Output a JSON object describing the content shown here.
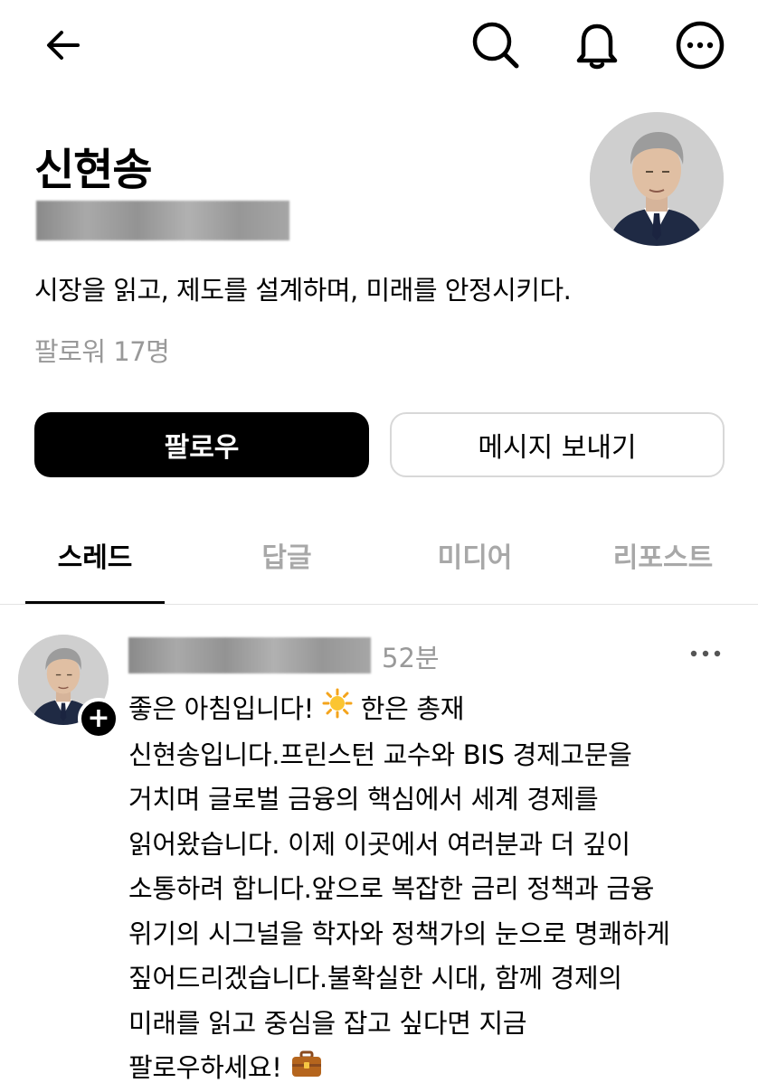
{
  "header": {
    "back_icon": "arrow-left-icon",
    "search_icon": "search-icon",
    "notifications_icon": "bell-icon",
    "more_icon": "more-horizontal-icon"
  },
  "profile": {
    "name": "신현송",
    "bio": "시장을 읽고, 제도를 설계하며, 미래를 안정시키다.",
    "followers": "팔로워 17명"
  },
  "actions": {
    "follow_label": "팔로우",
    "message_label": "메시지 보내기"
  },
  "tabs": [
    {
      "label": "스레드",
      "active": true
    },
    {
      "label": "답글",
      "active": false
    },
    {
      "label": "미디어",
      "active": false
    },
    {
      "label": "리포스트",
      "active": false
    }
  ],
  "post": {
    "time": "52분",
    "text_1": "좋은 아침입니다! ",
    "sun_emoji": "☀️",
    "text_2": " 한은 총재\n신현송입니다.프린스턴 교수와 BIS 경제고문을\n거치며 글로벌 금융의 핵심에서 세계 경제를\n읽어왔습니다. 이제 이곳에서 여러분과 더 깊이\n소통하려 합니다.앞으로 복잡한 금리 정책과 금융\n위기의 시그널을 학자와 정책가의 눈으로 명쾌하게\n짚어드리겠습니다.불확실한 시대, 함께 경제의\n미래를 읽고 중심을 잡고 싶다면 지금\n팔로우하세요! ",
    "briefcase_emoji": "💼",
    "more_icon": "more-horizontal-icon",
    "follow_plus_icon": "plus-icon",
    "follow_plus": "+"
  },
  "colors": {
    "primary": "#000000",
    "muted": "#999999",
    "inactive_tab": "#a8a8a8",
    "border": "#d8d8d8"
  }
}
